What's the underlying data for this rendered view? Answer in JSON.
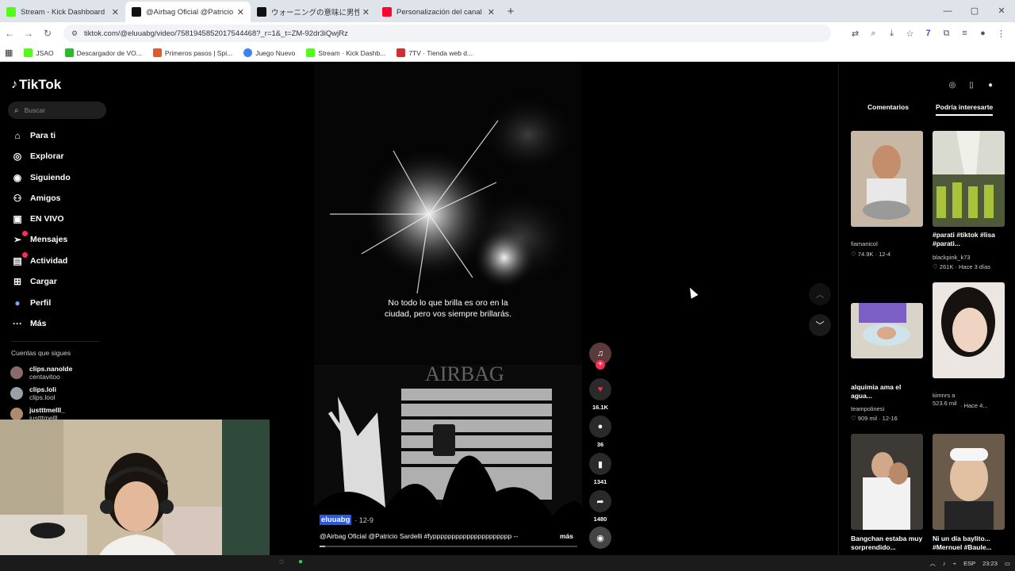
{
  "browser": {
    "tabs": [
      {
        "title": "Stream - Kick Dashboard",
        "color": "#53fc18"
      },
      {
        "title": "@Airbag Oficial @Patricio Sard",
        "color": "#111111"
      },
      {
        "title": "ウォーニングの意味に男性が大喜",
        "color": "#111111"
      },
      {
        "title": "Personalización del canal - You",
        "color": "#ff0033"
      }
    ],
    "url": "tiktok.com/@eluuabg/video/7581945852017544468?_r=1&_t=ZM-92dr3iQwjRz",
    "bookmarks": [
      {
        "label": "JSAO",
        "color": "#53fc18"
      },
      {
        "label": "Descargador de VO...",
        "color": "#2db82d"
      },
      {
        "label": "Primeros pasos | Spi...",
        "color": "#e05a2b"
      },
      {
        "label": "Juego Nuevo",
        "color": "#3b82f6"
      },
      {
        "label": "Stream · Kick Dashb...",
        "color": "#53fc18"
      },
      {
        "label": "7TV · Tienda web d...",
        "color": "#d03030"
      }
    ]
  },
  "sidebar": {
    "logo": "TikTok",
    "search_placeholder": "Buscar",
    "nav": [
      {
        "label": "Para ti",
        "icon": "home-icon",
        "glyph": "⌂"
      },
      {
        "label": "Explorar",
        "icon": "compass-icon",
        "glyph": "◎"
      },
      {
        "label": "Siguiendo",
        "icon": "following-icon",
        "glyph": "◉"
      },
      {
        "label": "Amigos",
        "icon": "friends-icon",
        "glyph": "⚇"
      },
      {
        "label": "EN VIVO",
        "icon": "live-icon",
        "glyph": "▣"
      },
      {
        "label": "Mensajes",
        "icon": "send-icon",
        "glyph": "➢"
      },
      {
        "label": "Actividad",
        "icon": "inbox-icon",
        "glyph": "▤"
      },
      {
        "label": "Cargar",
        "icon": "upload-icon",
        "glyph": "⊞"
      },
      {
        "label": "Perfil",
        "icon": "profile-icon",
        "glyph": "●"
      },
      {
        "label": "Más",
        "icon": "more-icon",
        "glyph": "···"
      }
    ],
    "following_title": "Cuentas que sigues",
    "following": [
      {
        "name": "clips.nanolde",
        "handle": "centavitoo"
      },
      {
        "name": "clips.loli",
        "handle": "clips.lool"
      },
      {
        "name": "justttmelll_",
        "handle": "justttmelll_"
      }
    ]
  },
  "video": {
    "subtitle_line1": "No todo lo que brilla es oro en la",
    "subtitle_line2": "ciudad, pero vos siempre brillarás.",
    "username": "eluuabg",
    "date": "· 12-9",
    "description": "@Airbag Oficial @Patricio Sardelli #fyppppppppppppppppppppp --",
    "more_label": "más",
    "progress": 0.02
  },
  "actions": {
    "likes": "16.1K",
    "comments": "36",
    "saves": "1341",
    "shares": "1480"
  },
  "right_panel": {
    "tab_comments": "Comentarios",
    "tab_suggest": "Podría interesarte",
    "videos": [
      {
        "caption": "",
        "author": "fiamanicol",
        "stats": "♡ 74.9K · 12-4"
      },
      {
        "caption": "#parati #tiktok #lisa #parati...",
        "author": "blackpink_k73",
        "stats": "♡ 261K · Hace 3 días"
      },
      {
        "caption": "alquimia ama el agua...",
        "author": "teampolinesi",
        "stats": "♡ 909 mil · 12-16"
      },
      {
        "caption": "",
        "author": "kimnrs a 523.6 mil",
        "stats": "· Hace 4..."
      },
      {
        "caption": "Bangchan estaba muy sorprendido...",
        "author": "",
        "stats": ""
      },
      {
        "caption": "Ni un día baylito... #Mernuel #Baule...",
        "author": "",
        "stats": ""
      }
    ]
  },
  "taskbar": {
    "lang": "ESP",
    "time": "23:23"
  }
}
